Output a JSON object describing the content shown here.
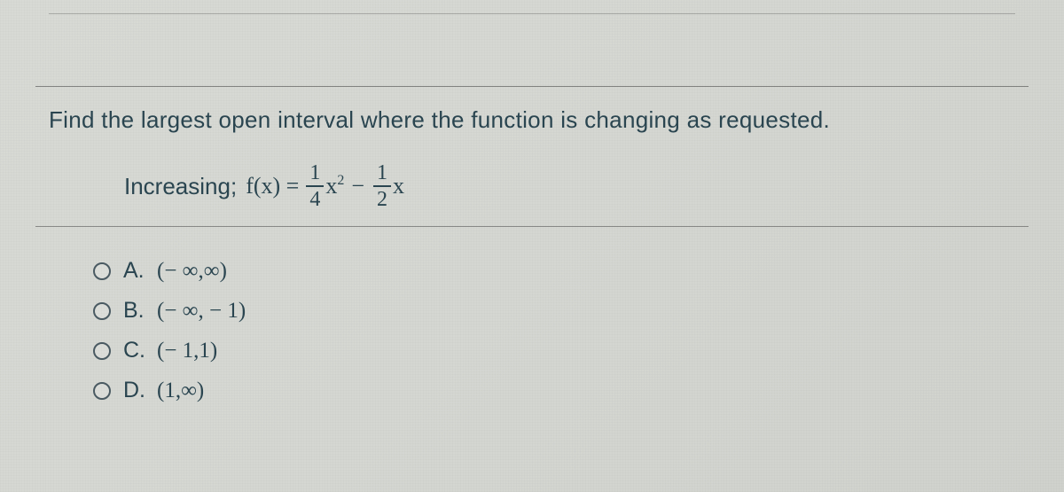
{
  "problem": {
    "prompt": "Find the largest open interval where the function is changing as requested.",
    "condition_label": "Increasing;",
    "function_lhs": "f(x) =",
    "frac1_num": "1",
    "frac1_den": "4",
    "term1_var": "x",
    "term1_exp": "2",
    "minus": "−",
    "frac2_num": "1",
    "frac2_den": "2",
    "term2_var": "x"
  },
  "options": {
    "a": {
      "letter": "A.",
      "text": "(− ∞,∞)"
    },
    "b": {
      "letter": "B.",
      "text": "(− ∞, − 1)"
    },
    "c": {
      "letter": "C.",
      "text": "(− 1,1)"
    },
    "d": {
      "letter": "D.",
      "text": "(1,∞)"
    }
  }
}
